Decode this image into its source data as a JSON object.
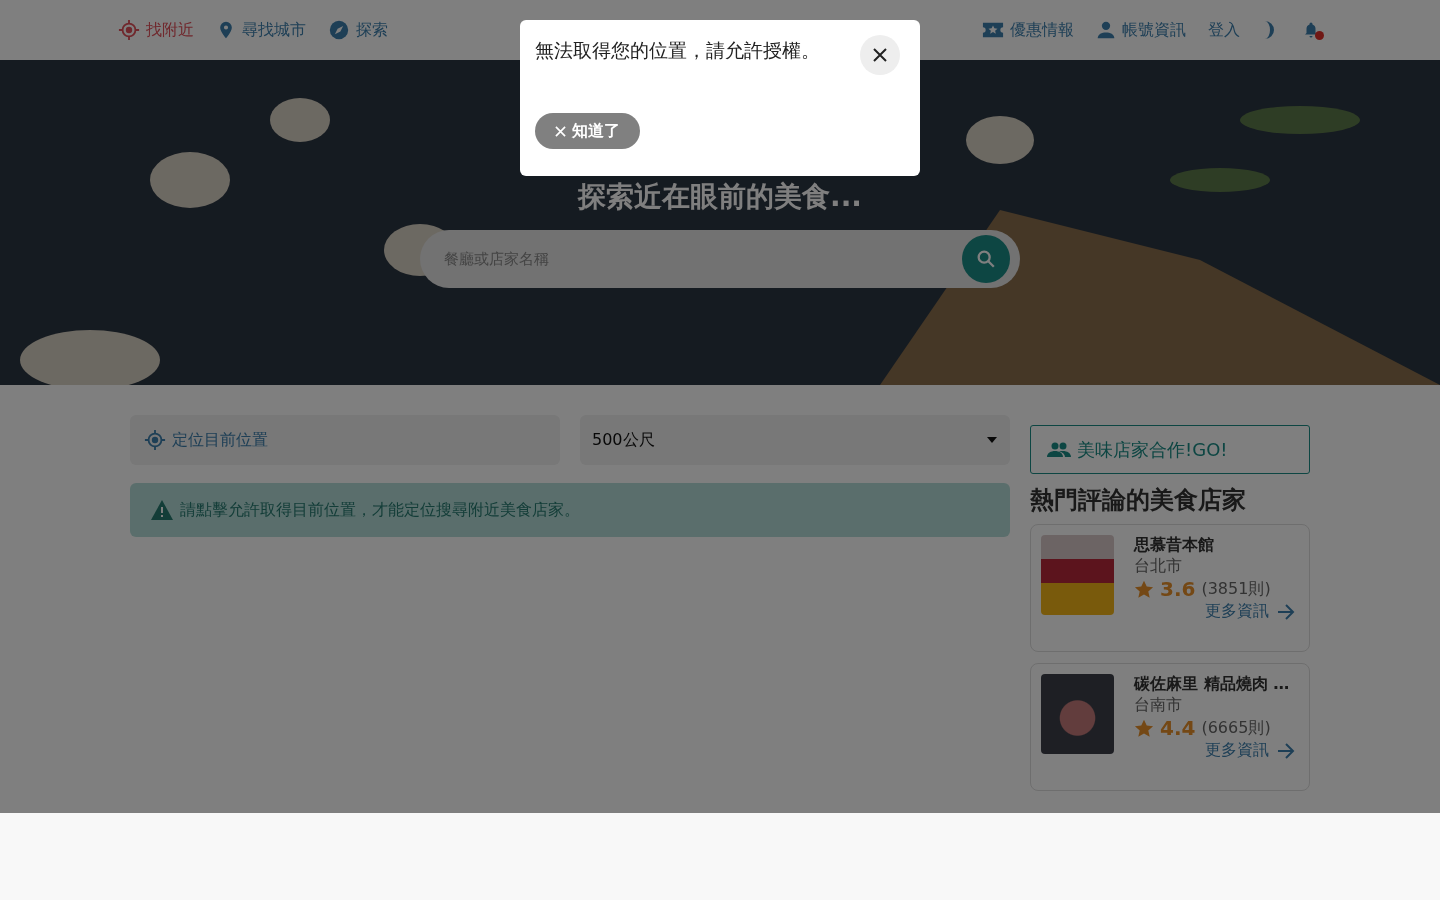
{
  "nav": {
    "left": [
      {
        "label": "找附近",
        "selected": true
      },
      {
        "label": "尋找城市",
        "selected": false
      },
      {
        "label": "探索",
        "selected": false
      }
    ],
    "right": [
      {
        "label": "優惠情報"
      },
      {
        "label": "帳號資訊"
      },
      {
        "label": "登入"
      }
    ],
    "notification_dot": true
  },
  "hero": {
    "title": "探索近在眼前的美食...",
    "search": {
      "placeholder": "餐廳或店家名稱"
    }
  },
  "location": {
    "locate_button": "定位目前位置",
    "distance": "500公尺",
    "alert": "請點擊允許取得目前位置，才能定位搜尋附近美食店家。"
  },
  "sidebar": {
    "partner_button": "美味店家合作!GO!",
    "heading": "熱門評論的美食店家",
    "restaurants": [
      {
        "name": "思慕昔本館",
        "city": "台北市",
        "rating": "3.6",
        "reviews": "(3851則)",
        "link": "更多資訊"
      },
      {
        "name": "碳佐麻里 精品燒肉 …",
        "city": "台南市",
        "rating": "4.4",
        "reviews": "(6665則)",
        "link": "更多資訊"
      }
    ]
  },
  "dialog": {
    "message": "無法取得您的位置，請允許授權。",
    "dismiss_button": "知道了",
    "open": true
  }
}
